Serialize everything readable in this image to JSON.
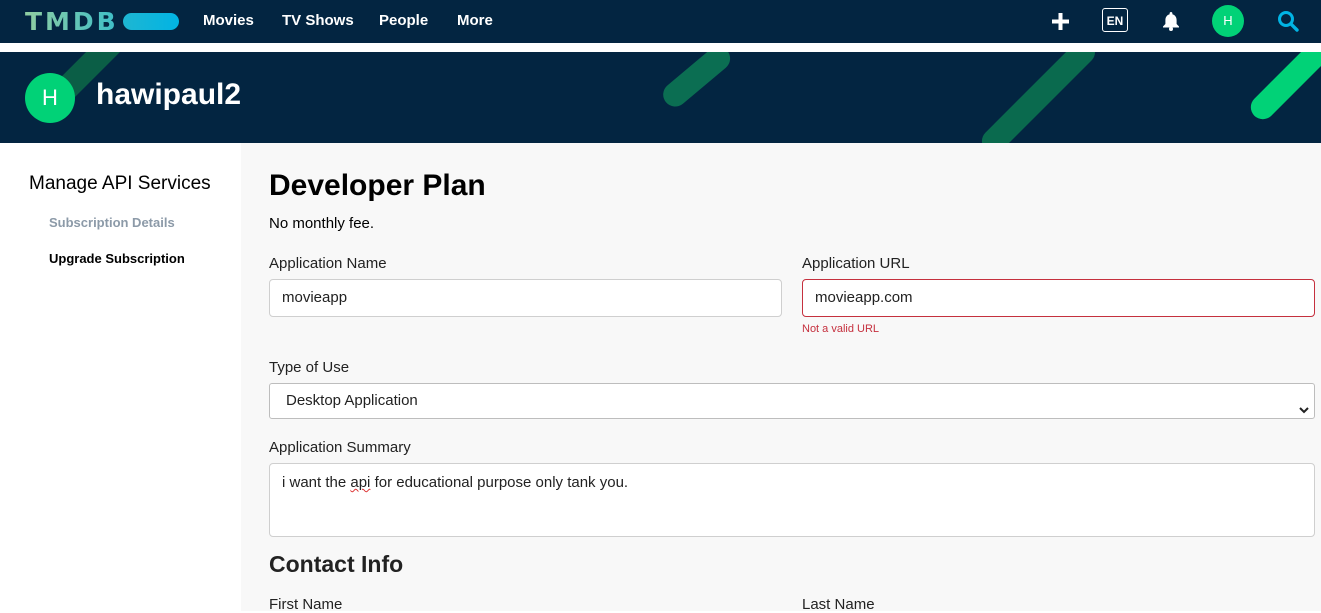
{
  "nav": {
    "logo_text": "TMDB",
    "links": [
      "Movies",
      "TV Shows",
      "People",
      "More"
    ],
    "language": "EN",
    "avatar_initial": "H",
    "icons": [
      "plus-icon",
      "bell-icon",
      "search-icon"
    ]
  },
  "banner": {
    "avatar_initial": "H",
    "username": "hawipaul2"
  },
  "sidebar": {
    "title": "Manage API Services",
    "items": [
      {
        "label": "Subscription Details"
      },
      {
        "label": "Upgrade Subscription"
      }
    ]
  },
  "form": {
    "plan_title": "Developer Plan",
    "plan_fee": "No monthly fee.",
    "app_name": {
      "label": "Application Name",
      "value": "movieapp"
    },
    "app_url": {
      "label": "Application URL",
      "value": "movieapp.com",
      "error": "Not a valid URL"
    },
    "type_of_use": {
      "label": "Type of Use",
      "selected": "Desktop Application"
    },
    "summary": {
      "label": "Application Summary",
      "value_before": "i want the ",
      "value_misspelled": "api",
      "value_after": " for educational purpose only tank you."
    },
    "contact_title": "Contact Info",
    "first_name": {
      "label": "First Name"
    },
    "last_name": {
      "label": "Last Name"
    }
  },
  "colors": {
    "nav_bg": "#032541",
    "accent_green": "#01d277",
    "error_red": "#c5303e",
    "logo_green": "#90cea1",
    "logo_blue": "#01b4e4"
  }
}
